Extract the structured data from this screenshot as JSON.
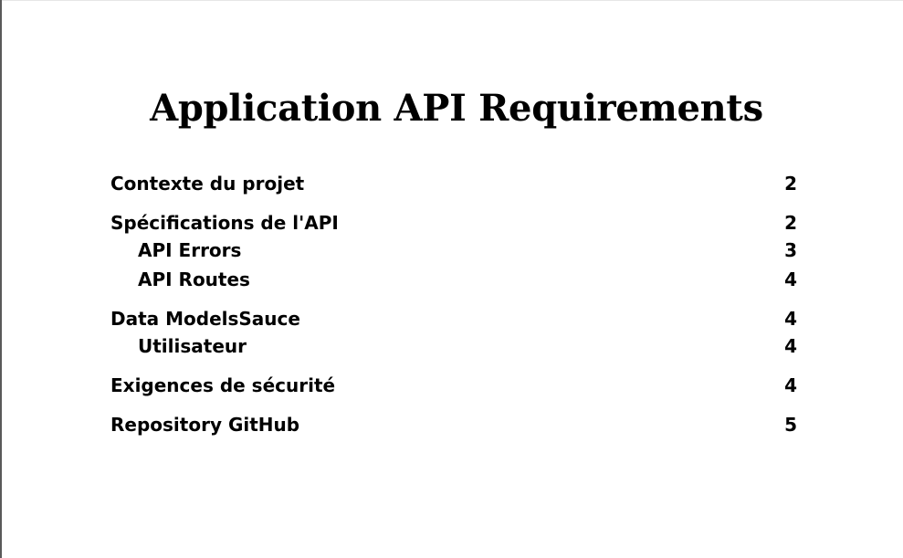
{
  "document": {
    "title": "Application API Requirements"
  },
  "toc": {
    "entries": [
      {
        "label": "Contexte du projet",
        "page": "2",
        "level": 1
      },
      {
        "label": "Spécifications de l'API",
        "page": "2",
        "level": 1
      },
      {
        "label": "API Errors",
        "page": "3",
        "level": 2
      },
      {
        "label": "API Routes",
        "page": "4",
        "level": 2
      },
      {
        "label": "Data ModelsSauce",
        "page": "4",
        "level": 1
      },
      {
        "label": "Utilisateur",
        "page": "4",
        "level": 2
      },
      {
        "label": "Exigences de sécurité",
        "page": "4",
        "level": 1
      },
      {
        "label": "Repository GitHub",
        "page": "5",
        "level": 1
      }
    ]
  }
}
